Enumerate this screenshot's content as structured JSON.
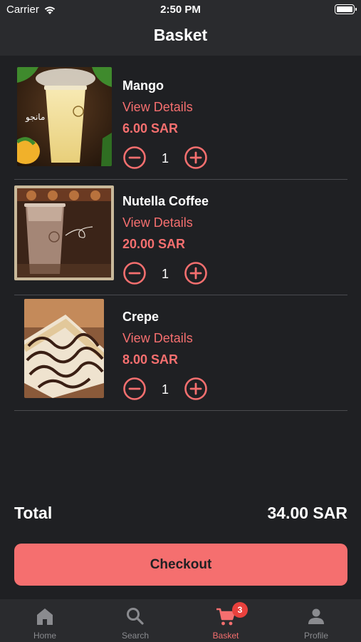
{
  "status_bar": {
    "carrier": "Carrier",
    "time": "2:50 PM"
  },
  "header": {
    "title": "Basket"
  },
  "items": [
    {
      "name": "Mango",
      "details_label": "View Details",
      "price": "6.00 SAR",
      "quantity": "1",
      "image_text": "مانجو"
    },
    {
      "name": "Nutella Coffee",
      "details_label": "View Details",
      "price": "20.00 SAR",
      "quantity": "1"
    },
    {
      "name": "Crepe",
      "details_label": "View Details",
      "price": "8.00 SAR",
      "quantity": "1"
    }
  ],
  "total": {
    "label": "Total",
    "value": "34.00 SAR"
  },
  "checkout": {
    "label": "Checkout"
  },
  "tabbar": {
    "tabs": [
      {
        "label": "Home",
        "icon": "home-icon"
      },
      {
        "label": "Search",
        "icon": "search-icon"
      },
      {
        "label": "Basket",
        "icon": "cart-icon",
        "badge": "3",
        "active": true
      },
      {
        "label": "Profile",
        "icon": "person-icon"
      }
    ]
  },
  "colors": {
    "accent": "#f56f6f",
    "background": "#1f2023",
    "bar": "#2a2b2e",
    "badge": "#e9413d",
    "inactive": "#8a8b8f"
  }
}
